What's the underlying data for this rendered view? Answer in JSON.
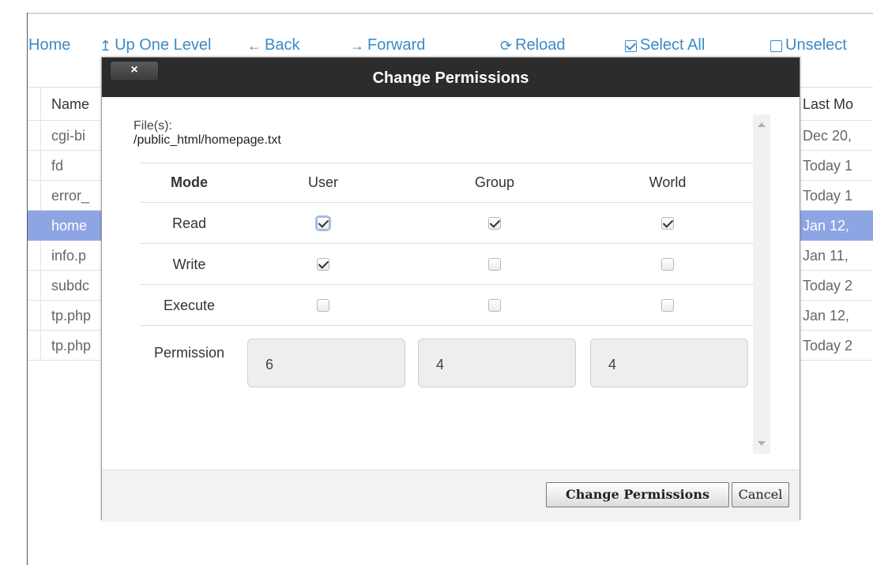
{
  "toolbar": {
    "home": "Home",
    "up": "Up One Level",
    "back": "Back",
    "forward": "Forward",
    "reload": "Reload",
    "select_all": "Select All",
    "unselect": "Unselect"
  },
  "table": {
    "header": {
      "name": "Name",
      "date": "Last Mo"
    },
    "rows": [
      {
        "name": "cgi-bi",
        "date": "Dec 20,"
      },
      {
        "name": "fd",
        "date": "Today 1"
      },
      {
        "name": "error_",
        "date": "Today 1"
      },
      {
        "name": "home",
        "date": "Jan 12,",
        "selected": true
      },
      {
        "name": "info.p",
        "date": "Jan 11,"
      },
      {
        "name": "subdc",
        "date": "Today 2"
      },
      {
        "name": "tp.php",
        "date": "Jan 12,"
      },
      {
        "name": "tp.php",
        "date": "Today 2"
      }
    ]
  },
  "dialog": {
    "close_label": "×",
    "title": "Change Permissions",
    "files_label": "File(s):",
    "files_path": "/public_html/homepage.txt",
    "headers": {
      "mode": "Mode",
      "user": "User",
      "group": "Group",
      "world": "World"
    },
    "rows": [
      {
        "mode": "Read",
        "user": true,
        "group": true,
        "world": true
      },
      {
        "mode": "Write",
        "user": true,
        "group": false,
        "world": false
      },
      {
        "mode": "Execute",
        "user": false,
        "group": false,
        "world": false
      }
    ],
    "permission_label": "Permission",
    "permission_values": {
      "user": "6",
      "group": "4",
      "world": "4"
    },
    "submit_label": "Change Permissions",
    "cancel_label": "Cancel"
  },
  "colors": {
    "link": "#3a8bc9",
    "selected_row": "#8ea5e4",
    "header_bar": "#2c2c2c"
  }
}
